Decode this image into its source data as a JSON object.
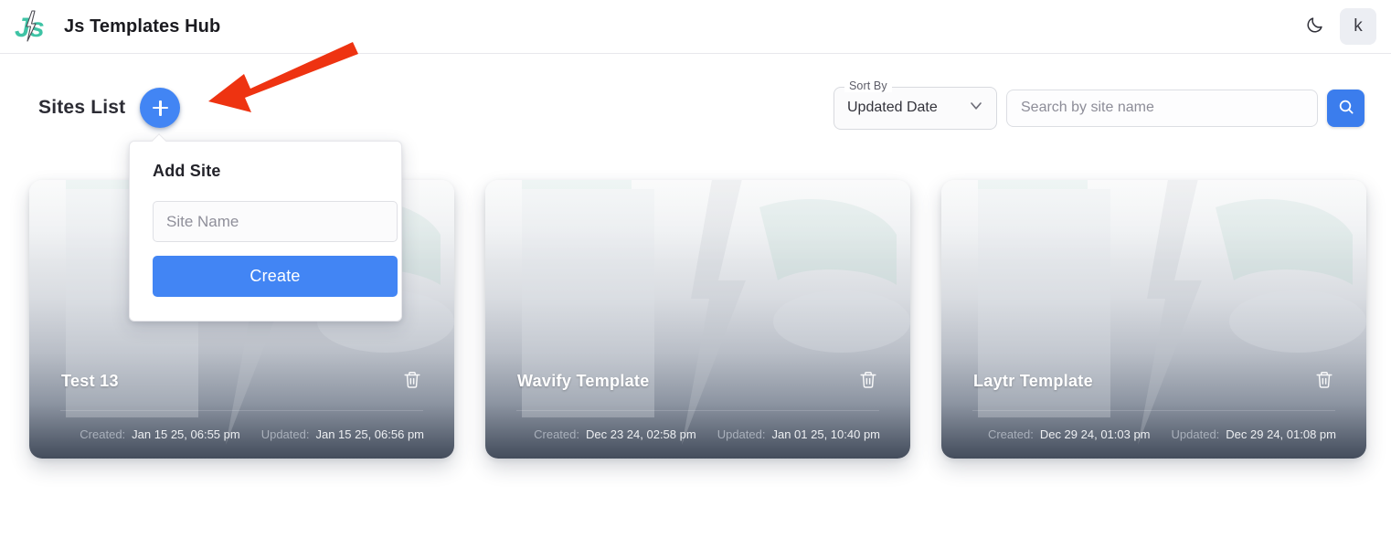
{
  "appbar": {
    "logo_icon": "js-lightning-logo-icon",
    "title": "Js Templates Hub",
    "theme_toggle_icon": "moon-icon",
    "avatar_label": "k"
  },
  "toolbar": {
    "page_title": "Sites List",
    "add_site_icon": "plus-icon",
    "sort": {
      "label": "Sort By",
      "value": "Updated Date",
      "chevron_icon": "chevron-down-icon"
    },
    "search": {
      "placeholder": "Search by site name",
      "value": "",
      "button_icon": "search-icon"
    }
  },
  "popover": {
    "title": "Add Site",
    "input_placeholder": "Site Name",
    "input_value": "",
    "create_label": "Create"
  },
  "cards": [
    {
      "title": "Test 13",
      "created_label": "Created:",
      "created_value": "Jan 15 25, 06:55 pm",
      "updated_label": "Updated:",
      "updated_value": "Jan 15 25, 06:56 pm",
      "delete_icon": "trash-icon"
    },
    {
      "title": "Wavify Template",
      "created_label": "Created:",
      "created_value": "Dec 23 24, 02:58 pm",
      "updated_label": "Updated:",
      "updated_value": "Jan 01 25, 10:40 pm",
      "delete_icon": "trash-icon"
    },
    {
      "title": "Laytr Template",
      "created_label": "Created:",
      "created_value": "Dec 29 24, 01:03 pm",
      "updated_label": "Updated:",
      "updated_value": "Dec 29 24, 01:08 pm",
      "delete_icon": "trash-icon"
    }
  ],
  "annotation": {
    "arrow_icon": "red-arrow-icon",
    "color": "#ee3311"
  },
  "colors": {
    "primary_blue": "#4285f4",
    "search_blue": "#3b7ded",
    "logo_teal": "#3fc3a5",
    "card_dark": "#444d5c",
    "annotation_red": "#ee3311"
  }
}
